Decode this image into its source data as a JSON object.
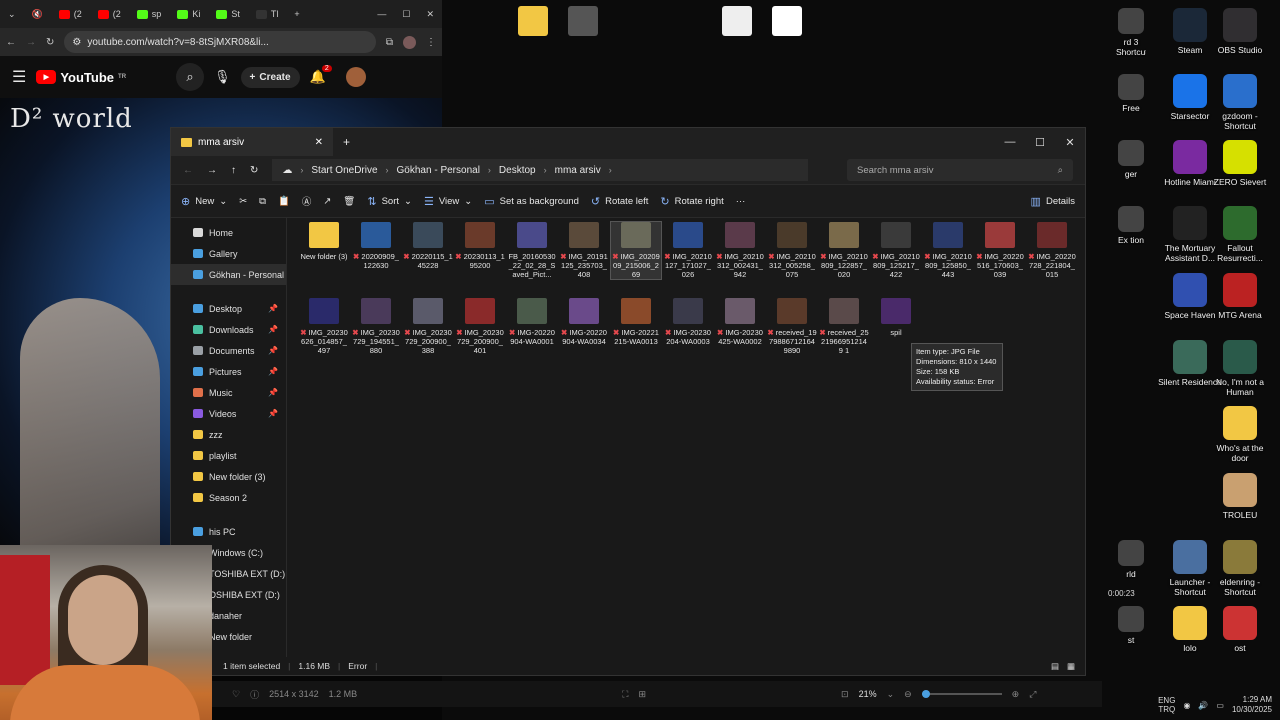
{
  "chrome": {
    "tabs": [
      {
        "label": "(2",
        "color": "#ff0000"
      },
      {
        "label": "(2",
        "color": "#ff0000"
      },
      {
        "label": "sp",
        "color": "#53fc18"
      },
      {
        "label": "Ki",
        "color": "#53fc18"
      },
      {
        "label": "St",
        "color": "#53fc18"
      },
      {
        "label": "Tl",
        "color": "#333333"
      }
    ],
    "url": "youtube.com/watch?v=8-8tSjMXR08&li..."
  },
  "youtube": {
    "logo": "YouTube",
    "region": "TR",
    "create_label": "Create",
    "notifications": "2",
    "video_overlay_title": "D² world"
  },
  "desktop_top_icons": [
    {
      "name": "folder-icon",
      "color": "#f2c744"
    },
    {
      "name": "file-icon",
      "color": "#555555"
    },
    {
      "name": "document-icon",
      "color": "#eeeeee"
    },
    {
      "name": "document-icon",
      "color": "#ffffff"
    }
  ],
  "desktop_icons": [
    {
      "label": "rd 3 Shortcut",
      "icon": "app-icon",
      "color": "#444444"
    },
    {
      "label": "Steam",
      "icon": "steam-icon",
      "color": "#1b2838"
    },
    {
      "label": "OBS Studio",
      "icon": "obs-icon",
      "color": "#302e31"
    },
    {
      "label": "Free",
      "icon": "app-icon",
      "color": "#444444"
    },
    {
      "label": "Starsector",
      "icon": "starsector-icon",
      "color": "#1a73e8"
    },
    {
      "label": "gzdoom - Shortcut",
      "icon": "gzdoom-icon",
      "color": "#2a6fcc"
    },
    {
      "label": "ger",
      "icon": "app-icon",
      "color": "#444444"
    },
    {
      "label": "Hotline Miami",
      "icon": "hotline-icon",
      "color": "#7a2aa0"
    },
    {
      "label": "ZERO Sievert",
      "icon": "zero-sievert-icon",
      "color": "#d6e000"
    },
    {
      "label": "Ex tion",
      "icon": "app-icon",
      "color": "#444444"
    },
    {
      "label": "The Mortuary Assistant D...",
      "icon": "mortuary-icon",
      "color": "#222222"
    },
    {
      "label": "Fallout Resurrecti...",
      "icon": "fallout-icon",
      "color": "#2d6b2d"
    },
    {
      "label": "Space Haven",
      "icon": "space-haven-icon",
      "color": "#3050b0"
    },
    {
      "label": "MTG Arena",
      "icon": "mtg-icon",
      "color": "#bb2222"
    },
    {
      "label": "Silent Residence",
      "icon": "silent-residence-icon",
      "color": "#3a6a5a"
    },
    {
      "label": "No, I'm not a Human",
      "icon": "not-human-icon",
      "color": "#2a5a4a"
    },
    {
      "label": "Who's at the door",
      "icon": "folder-icon",
      "color": "#f2c744"
    },
    {
      "label": "TROLEU",
      "icon": "troleu-icon",
      "color": "#c9a070"
    },
    {
      "label": "rld",
      "icon": "app-icon",
      "color": "#444444"
    },
    {
      "label": "Launcher - Shortcut",
      "icon": "launcher-icon",
      "color": "#4a6fa0"
    },
    {
      "label": "eldenring - Shortcut",
      "icon": "elden-ring-icon",
      "color": "#8a7a3a"
    },
    {
      "label": "st",
      "icon": "app-icon",
      "color": "#444444"
    },
    {
      "label": "lolo",
      "icon": "folder-icon",
      "color": "#f2c744"
    },
    {
      "label": "ost",
      "icon": "app-icon",
      "color": "#cc3333"
    }
  ],
  "explorer": {
    "tab_title": "mma arsiv",
    "breadcrumb": [
      "Start OneDrive",
      "Gökhan - Personal",
      "Desktop",
      "mma arsiv"
    ],
    "search_placeholder": "Search mma arsiv",
    "toolbar": {
      "new": "New",
      "sort": "Sort",
      "view": "View",
      "set_background": "Set as background",
      "rotate_left": "Rotate left",
      "rotate_right": "Rotate right",
      "more": "···",
      "details": "Details"
    },
    "nav_items": [
      {
        "label": "Home",
        "icon": "home-icon",
        "color": "#d9d9d9"
      },
      {
        "label": "Gallery",
        "icon": "gallery-icon",
        "color": "#4a9fe0"
      },
      {
        "label": "Gökhan - Personal",
        "icon": "onedrive-icon",
        "color": "#4a9fe0"
      },
      {
        "label": "Desktop",
        "icon": "desktop-icon",
        "color": "#4a9fe0",
        "pinned": true
      },
      {
        "label": "Downloads",
        "icon": "downloads-icon",
        "color": "#4ac0a0",
        "pinned": true
      },
      {
        "label": "Documents",
        "icon": "documents-icon",
        "color": "#9aa0a6",
        "pinned": true
      },
      {
        "label": "Pictures",
        "icon": "pictures-icon",
        "color": "#4a9fe0",
        "pinned": true
      },
      {
        "label": "Music",
        "icon": "music-icon",
        "color": "#e0704a",
        "pinned": true
      },
      {
        "label": "Videos",
        "icon": "videos-icon",
        "color": "#8a5ae0",
        "pinned": true
      },
      {
        "label": "zzz",
        "icon": "folder-icon",
        "color": "#f2c744"
      },
      {
        "label": "playlist",
        "icon": "folder-icon",
        "color": "#f2c744"
      },
      {
        "label": "New folder (3)",
        "icon": "folder-icon",
        "color": "#f2c744"
      },
      {
        "label": "Season 2",
        "icon": "folder-icon",
        "color": "#f2c744"
      },
      {
        "label": "his PC",
        "icon": "pc-icon",
        "color": "#4a9fe0"
      },
      {
        "label": "Windows (C:)",
        "icon": "drive-icon",
        "color": "#9aa0a6"
      },
      {
        "label": "TOSHIBA EXT (D:)",
        "icon": "drive-icon",
        "color": "#9aa0a6"
      },
      {
        "label": "OSHIBA EXT (D:)",
        "icon": "drive-icon",
        "color": "#9aa0a6"
      },
      {
        "label": "danaher",
        "icon": "folder-icon",
        "color": "#f2c744"
      },
      {
        "label": "New folder",
        "icon": "folder-icon",
        "color": "#f2c744"
      }
    ],
    "files_row1": [
      {
        "label": "New folder (3)",
        "error": false,
        "color": "#f2c744"
      },
      {
        "label": "20200909_122630",
        "error": true,
        "color": "#2a5a9a"
      },
      {
        "label": "20220115_145228",
        "error": true,
        "color": "#3a4a5a"
      },
      {
        "label": "20230113_195200",
        "error": true,
        "color": "#6a3a2a"
      },
      {
        "label": "FB_20160530_22_02_28_Saved_Pict...",
        "error": false,
        "color": "#4a4a8a"
      },
      {
        "label": "IMG_20191125_235703_408",
        "error": true,
        "color": "#5a4a3a"
      },
      {
        "label": "IMG_2020909_215006_269",
        "error": true,
        "color": "#6a6a5a"
      },
      {
        "label": "IMG_20210127_171027_026",
        "error": true,
        "color": "#2a4a8a"
      },
      {
        "label": "IMG_20210312_002431_942",
        "error": true,
        "color": "#5a3a4a"
      },
      {
        "label": "IMG_20210312_005258_075",
        "error": true,
        "color": "#4a3a2a"
      },
      {
        "label": "IMG_20210809_122857_020",
        "error": true,
        "color": "#7a6a4a"
      },
      {
        "label": "IMG_20210809_125217_422",
        "error": true,
        "color": "#3a3a3a"
      },
      {
        "label": "IMG_20210809_125850_443",
        "error": true,
        "color": "#2a3a6a"
      },
      {
        "label": "IMG_20220516_170603_039",
        "error": true,
        "color": "#9a3a3a"
      },
      {
        "label": "IMG_20220728_221804_015",
        "error": true,
        "color": "#6a2a2a"
      }
    ],
    "files_row2": [
      {
        "label": "IMG_20230626_014857_497",
        "error": true,
        "color": "#2a2a6a"
      },
      {
        "label": "IMG_20230729_194551_880",
        "error": true,
        "color": "#4a3a5a"
      },
      {
        "label": "IMG_20230729_200900_388",
        "error": true,
        "color": "#5a5a6a"
      },
      {
        "label": "IMG_20230729_200900_401",
        "error": true,
        "color": "#8a2a2a"
      },
      {
        "label": "IMG-20220904-WA0001",
        "error": true,
        "color": "#4a5a4a"
      },
      {
        "label": "IMG-20220904-WA0034",
        "error": true,
        "color": "#6a4a8a"
      },
      {
        "label": "IMG-20221215-WA0013",
        "error": true,
        "color": "#8a4a2a"
      },
      {
        "label": "IMG-20230204-WA0003",
        "error": true,
        "color": "#3a3a4a"
      },
      {
        "label": "IMG-20230425-WA0002",
        "error": true,
        "color": "#6a5a6a"
      },
      {
        "label": "received_19798867121649890",
        "error": true,
        "color": "#5a3a2a"
      },
      {
        "label": "received_25219669512149 1",
        "error": true,
        "color": "#5a4a4a"
      },
      {
        "label": "spil",
        "error": false,
        "color": "#4a2a6a"
      }
    ],
    "tooltip": {
      "type": "Item type: JPG File",
      "dimensions": "Dimensions: 810 x 1440",
      "size": "Size: 158 KB",
      "availability": "Availability status: Error"
    },
    "status": {
      "selected": "1 item selected",
      "size": "1.16 MB",
      "error": "Error"
    }
  },
  "photos_bar": {
    "resolution": "2514 x 3142",
    "filesize": "1.2 MB",
    "zoom": "21%",
    "time": "0:00:23"
  },
  "tray": {
    "lang": "ENG",
    "layout": "TRQ",
    "time": "1:29 AM",
    "date": "10/30/2025"
  }
}
